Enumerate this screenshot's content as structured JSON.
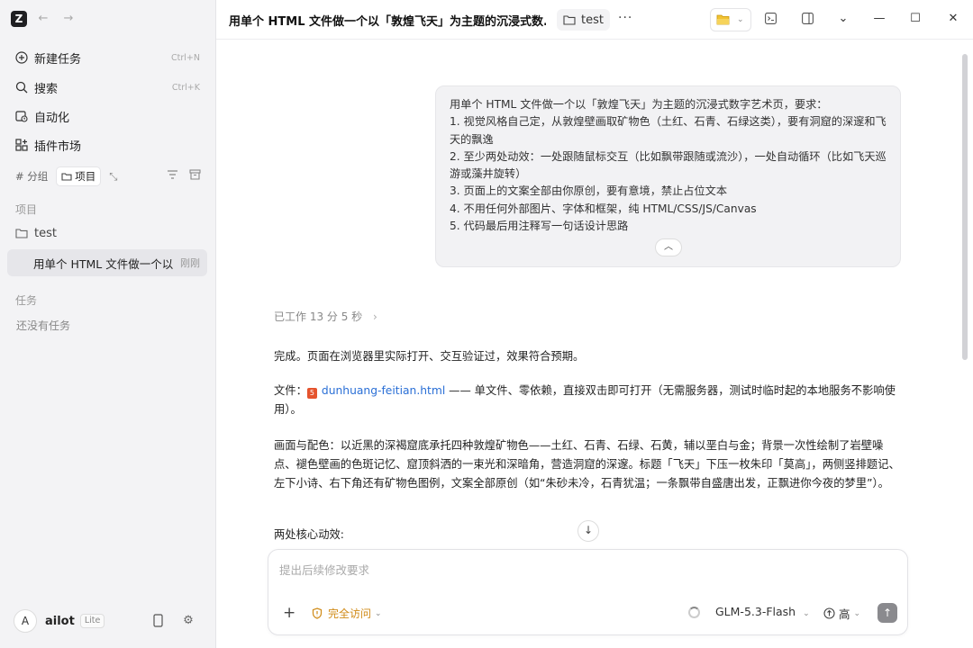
{
  "sidebar": {
    "logo": "Z",
    "menu": [
      {
        "label": "新建任务",
        "shortcut": "Ctrl+N",
        "icon": "plus-circle-icon"
      },
      {
        "label": "搜索",
        "shortcut": "Ctrl+K",
        "icon": "search-icon"
      },
      {
        "label": "自动化",
        "shortcut": "",
        "icon": "clock-calendar-icon"
      },
      {
        "label": "插件市场",
        "shortcut": "",
        "icon": "grid-plus-icon"
      }
    ],
    "filters": {
      "group": "# 分组",
      "project": "项目"
    },
    "projects_label": "项目",
    "project_name": "test",
    "task": {
      "title": "用单个 HTML 文件做一个以",
      "time": "刚刚"
    },
    "tasks_label": "任务",
    "empty_tasks": "还没有任务",
    "user": {
      "avatar": "A",
      "name": "ailot",
      "plan": "Lite"
    }
  },
  "header": {
    "title": "用单个 HTML 文件做一个以「敦煌飞天」为主题的沉浸式数...",
    "folder": "test"
  },
  "conversation": {
    "user_message": [
      "用单个 HTML 文件做一个以「敦煌飞天」为主题的沉浸式数字艺术页，要求：",
      "1. 视觉风格自己定，从敦煌壁画取矿物色（土红、石青、石绿这类），要有洞窟的深邃和飞天的飘逸",
      "2. 至少两处动效：一处跟随鼠标交互（比如飘带跟随或流沙），一处自动循环（比如飞天巡游或藻井旋转）",
      "3. 页面上的文案全部由你原创，要有意境，禁止占位文本",
      "4. 不用任何外部图片、字体和框架，纯 HTML/CSS/JS/Canvas",
      "5. 代码最后用注释写一句话设计思路"
    ],
    "worked": "已工作 13 分 5 秒",
    "reply_done": "完成。页面在浏览器里实际打开、交互验证过，效果符合预期。",
    "file_label": "文件：",
    "file_name": "dunhuang-feitian.html",
    "file_desc": " —— 单文件、零依赖，直接双击即可打开（无需服务器，测试时临时起的本地服务不影响使用）。",
    "palette_para": "画面与配色：以近黑的深褐窟底承托四种敦煌矿物色——土红、石青、石绿、石黄，辅以垩白与金；背景一次性绘制了岩壁噪点、褪色壁画的色斑记忆、窟顶斜洒的一束光和深暗角，营造洞窟的深邃。标题「飞天」下压一枚朱印「莫高」，两侧竖排题记、左下小诗、右下角还有矿物色图例，文案全部原创（如“朱砂未冷，石青犹温；一条飘带自盛唐出发，正飘进你今夜的梦里”）。",
    "effects_heading": "两处核心动效:"
  },
  "composer": {
    "placeholder": "提出后续修改要求",
    "access": "完全访问",
    "model": "GLM-5.3-Flash",
    "effort": "高"
  },
  "colors": {
    "accent": "#2a6fd6",
    "warning": "#d08a16",
    "html_icon": "#e5532d"
  }
}
